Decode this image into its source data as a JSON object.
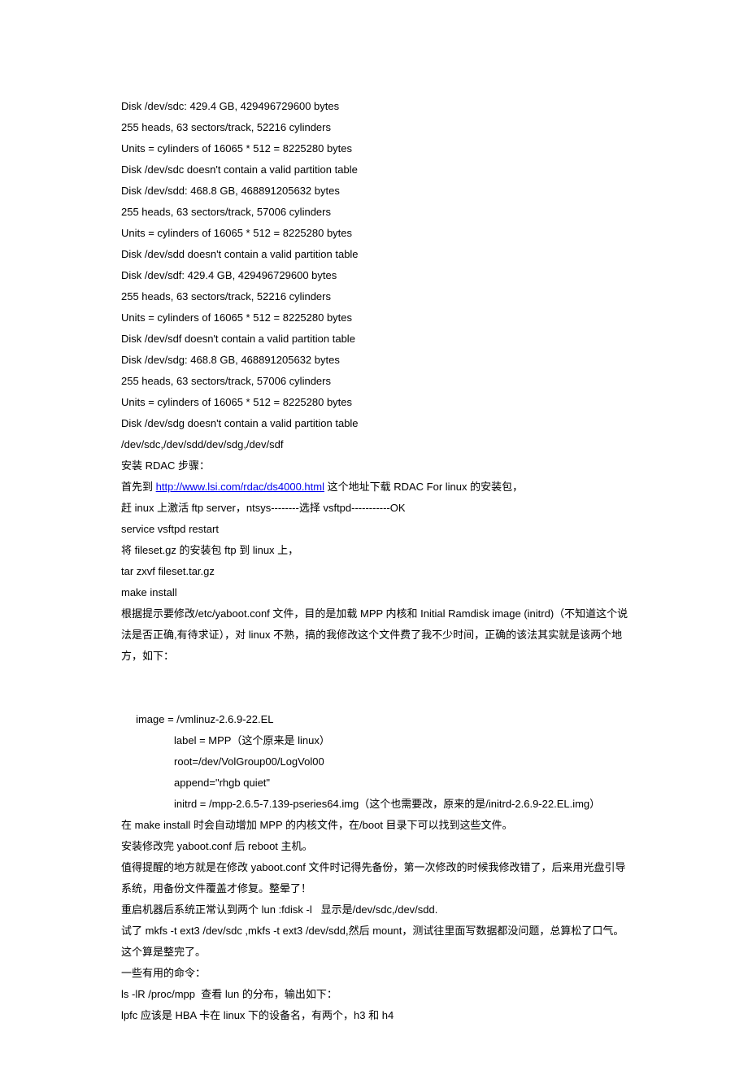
{
  "lines": {
    "l1": "Disk /dev/sdc: 429.4 GB, 429496729600 bytes",
    "l2": "255 heads, 63 sectors/track, 52216 cylinders",
    "l3": "Units = cylinders of 16065 * 512 = 8225280 bytes",
    "l4": "Disk /dev/sdc doesn't contain a valid partition table",
    "l5": "Disk /dev/sdd: 468.8 GB, 468891205632 bytes",
    "l6": "255 heads, 63 sectors/track, 57006 cylinders",
    "l7": "Units = cylinders of 16065 * 512 = 8225280 bytes",
    "l8": "Disk /dev/sdd doesn't contain a valid partition table",
    "l9": "Disk /dev/sdf: 429.4 GB, 429496729600 bytes",
    "l10": "255 heads, 63 sectors/track, 52216 cylinders",
    "l11": "Units = cylinders of 16065 * 512 = 8225280 bytes",
    "l12": "Disk /dev/sdf doesn't contain a valid partition table",
    "l13": "Disk /dev/sdg: 468.8 GB, 468891205632 bytes",
    "l14": "255 heads, 63 sectors/track, 57006 cylinders",
    "l15": "Units = cylinders of 16065 * 512 = 8225280 bytes",
    "l16": "Disk /dev/sdg doesn't contain a valid partition table",
    "l17": "/dev/sdc,/dev/sdd/dev/sdg,/dev/sdf",
    "l18": "安装 RDAC 步骤：",
    "l19a": "首先到 ",
    "l19b": "http://www.lsi.com/rdac/ds4000.html",
    "l19c": " 这个地址下载 RDAC For linux 的安装包，",
    "l20": "赶 inux 上激活 ftp server，ntsys--------选择 vsftpd-----------OK",
    "l21": "service vsftpd restart",
    "l22": "将 fileset.gz 的安装包 ftp 到 linux 上，",
    "l23": "tar zxvf fileset.tar.gz",
    "l24": "make install",
    "l25": "根据提示要修改/etc/yaboot.conf 文件，目的是加载 MPP 内核和 Initial Ramdisk image (initrd)（不知道这个说法是否正确,有待求证），对 linux 不熟，搞的我修改这个文件费了我不少时间，正确的该法其实就是该两个地方，如下：",
    "l26": "     image = /vmlinuz-2.6.9-22.EL",
    "l27": "                  label = MPP（这个原来是 linux）",
    "l28": "                  root=/dev/VolGroup00/LogVol00",
    "l29": "                  append=\"rhgb quiet\"",
    "l30": "                  initrd = /mpp-2.6.5-7.139-pseries64.img（这个也需要改，原来的是/initrd-2.6.9-22.EL.img）",
    "l31": "在 make install 时会自动增加 MPP 的内核文件，在/boot 目录下可以找到这些文件。",
    "l32": "安装修改完 yaboot.conf 后 reboot 主机。",
    "l33": "值得提醒的地方就是在修改 yaboot.conf 文件时记得先备份，第一次修改的时候我修改错了，后来用光盘引导系统，用备份文件覆盖才修复。整晕了！",
    "l34": "重启机器后系统正常认到两个 lun :fdisk -l   显示是/dev/sdc,/dev/sdd.",
    "l35": "试了 mkfs -t ext3 /dev/sdc ,mkfs -t ext3 /dev/sdd,然后 mount，测试往里面写数据都没问题，总算松了口气。这个算是整完了。",
    "l36": "一些有用的命令：",
    "l37": "ls -lR /proc/mpp  查看 lun 的分布，输出如下：",
    "l38": "lpfc 应该是 HBA 卡在 linux 下的设备名，有两个，h3 和 h4"
  }
}
